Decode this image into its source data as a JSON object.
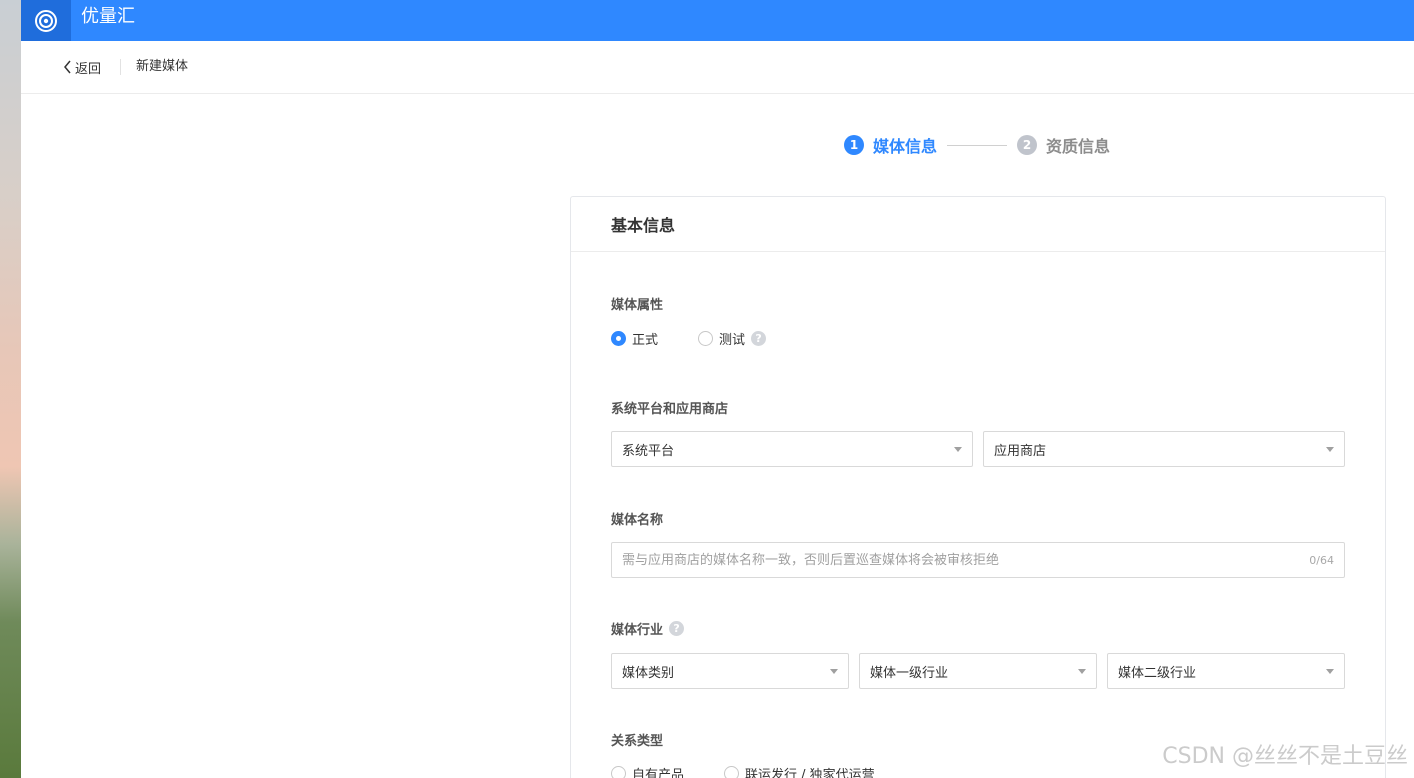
{
  "app": {
    "title": "优量汇",
    "logo_icon": "target-logo-icon",
    "brand_color": "#2f88ff"
  },
  "subheader": {
    "back_label": "返回",
    "page_title": "新建媒体"
  },
  "steps": [
    {
      "num": "1",
      "label": "媒体信息",
      "state": "active"
    },
    {
      "num": "2",
      "label": "资质信息",
      "state": "inactive"
    }
  ],
  "card": {
    "title": "基本信息",
    "media_attr": {
      "label": "媒体属性",
      "options": [
        {
          "label": "正式",
          "checked": true
        },
        {
          "label": "测试",
          "checked": false
        }
      ],
      "help_icon": "?"
    },
    "platform": {
      "label": "系统平台和应用商店",
      "system_platform": "系统平台",
      "app_store": "应用商店"
    },
    "media_name": {
      "label": "媒体名称",
      "placeholder": "需与应用商店的媒体名称一致，否则后置巡查媒体将会被审核拒绝",
      "value": "",
      "counter": "0/64"
    },
    "industry": {
      "label": "媒体行业",
      "help_icon": "?",
      "category": "媒体类别",
      "level1": "媒体一级行业",
      "level2": "媒体二级行业"
    },
    "relation": {
      "label": "关系类型",
      "options": [
        {
          "label": "自有产品",
          "checked": false
        },
        {
          "label": "联运发行 / 独家代运营",
          "checked": false
        }
      ]
    }
  },
  "watermark": "CSDN @丝丝不是土豆丝"
}
